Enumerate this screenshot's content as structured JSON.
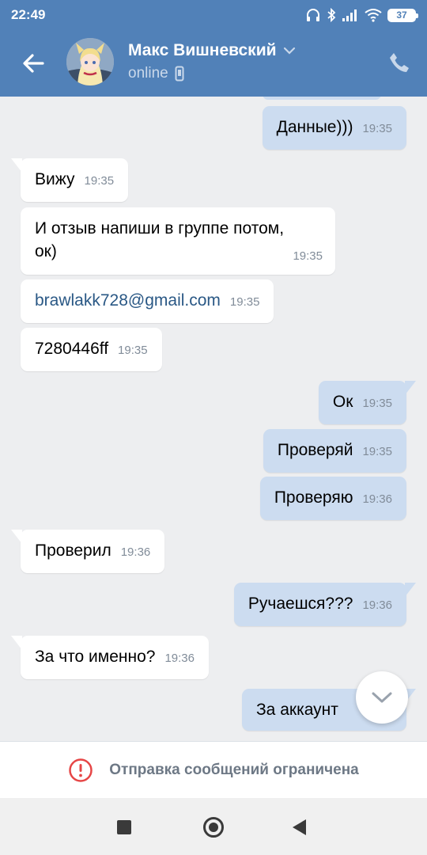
{
  "status_bar": {
    "time": "22:49",
    "battery": "37"
  },
  "header": {
    "contact_name": "Макс Вишневский",
    "status": "online"
  },
  "messages": [
    {
      "direction": "out",
      "text": "Данные)))",
      "time": "19:35"
    },
    {
      "direction": "in",
      "text": "Вижу",
      "time": "19:35"
    },
    {
      "direction": "in",
      "text": "И отзыв напиши в группе потом,\nок)",
      "time": "19:35"
    },
    {
      "direction": "in",
      "text": "brawlakk728@gmail.com",
      "time": "19:35",
      "is_link": true
    },
    {
      "direction": "in",
      "text": "7280446ff",
      "time": "19:35"
    },
    {
      "direction": "out",
      "text": "Ок",
      "time": "19:35"
    },
    {
      "direction": "out",
      "text": "Проверяй",
      "time": "19:35"
    },
    {
      "direction": "out",
      "text": "Проверяю",
      "time": "19:36"
    },
    {
      "direction": "in",
      "text": "Проверил",
      "time": "19:36"
    },
    {
      "direction": "out",
      "text": "Ручаешся???",
      "time": "19:36"
    },
    {
      "direction": "in",
      "text": "За что именно?",
      "time": "19:36"
    },
    {
      "direction": "out",
      "text": "За аккаунт",
      "time": ""
    }
  ],
  "footer": {
    "restriction_text": "Отправка сообщений ограничена"
  },
  "colors": {
    "header_bg": "#5181b8",
    "chat_bg": "#edeef0",
    "incoming_bubble": "#ffffff",
    "outgoing_bubble": "#ccdcf0",
    "link": "#2a5885",
    "alert_red": "#e64646"
  },
  "icons": {
    "back": "arrow-left-icon",
    "dropdown": "chevron-down-icon",
    "device": "mobile-icon",
    "call": "phone-icon",
    "scroll": "chevron-down-icon",
    "alert": "exclamation-circle-icon"
  }
}
